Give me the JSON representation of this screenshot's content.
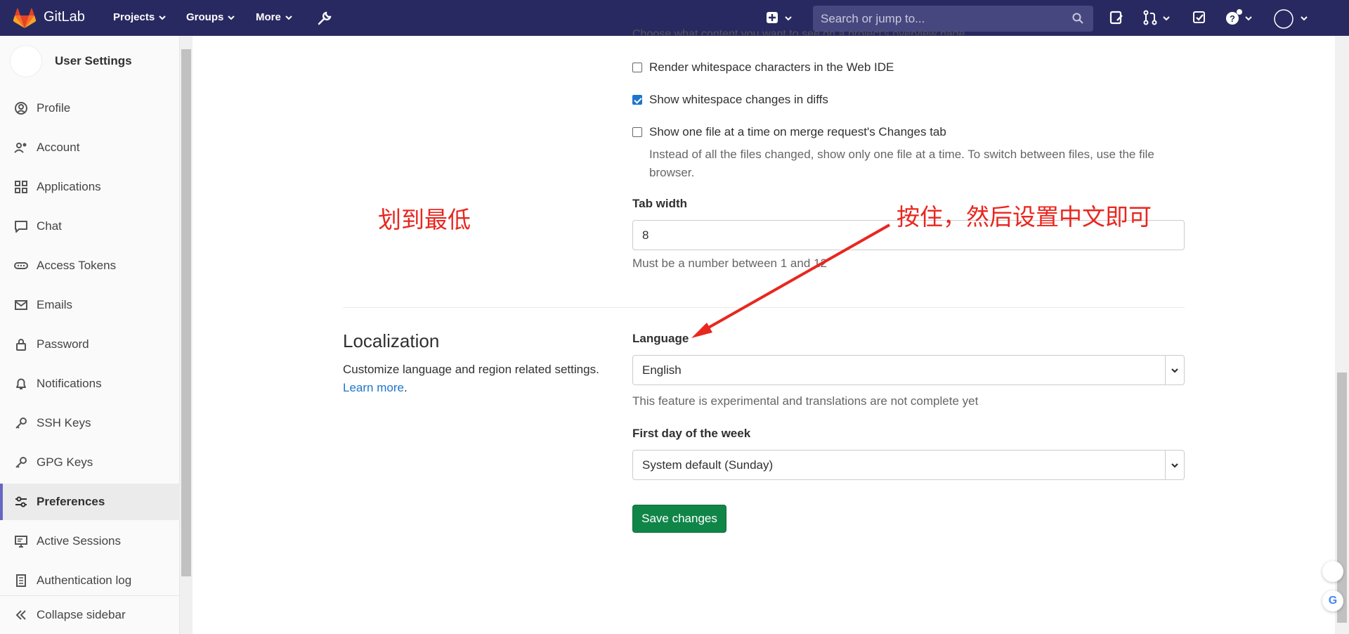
{
  "topbar": {
    "brand": "GitLab",
    "nav": [
      "Projects",
      "Groups",
      "More"
    ],
    "search_placeholder": "Search or jump to..."
  },
  "sidebar": {
    "title": "User Settings",
    "items": [
      {
        "label": "Profile",
        "icon": "profile-icon"
      },
      {
        "label": "Account",
        "icon": "account-icon"
      },
      {
        "label": "Applications",
        "icon": "applications-icon"
      },
      {
        "label": "Chat",
        "icon": "chat-icon"
      },
      {
        "label": "Access Tokens",
        "icon": "token-icon"
      },
      {
        "label": "Emails",
        "icon": "mail-icon"
      },
      {
        "label": "Password",
        "icon": "lock-icon"
      },
      {
        "label": "Notifications",
        "icon": "bell-icon"
      },
      {
        "label": "SSH Keys",
        "icon": "key-icon"
      },
      {
        "label": "GPG Keys",
        "icon": "key-icon"
      },
      {
        "label": "Preferences",
        "icon": "preferences-icon",
        "active": true
      },
      {
        "label": "Active Sessions",
        "icon": "monitor-icon"
      },
      {
        "label": "Authentication log",
        "icon": "log-icon"
      }
    ],
    "collapse_label": "Collapse sidebar"
  },
  "behavior": {
    "cut_text": "Choose what content you want to see on a project's overview page.",
    "checkboxes": [
      {
        "label": "Render whitespace characters in the Web IDE",
        "checked": false
      },
      {
        "label": "Show whitespace changes in diffs",
        "checked": true
      },
      {
        "label": "Show one file at a time on merge request's Changes tab",
        "checked": false
      }
    ],
    "one_file_help": "Instead of all the files changed, show only one file at a time. To switch between files, use the file browser.",
    "tab_width_label": "Tab width",
    "tab_width_value": "8",
    "tab_width_hint": "Must be a number between 1 and 12"
  },
  "localization": {
    "title": "Localization",
    "description": "Customize language and region related settings.",
    "learn_more": "Learn more",
    "learn_more_suffix": ".",
    "language_label": "Language",
    "language_value": "English",
    "language_hint": "This feature is experimental and translations are not complete yet",
    "first_day_label": "First day of the week",
    "first_day_value": "System default (Sunday)"
  },
  "save_label": "Save changes",
  "annotations": {
    "left_note": "划到最低",
    "right_note": "按住，然后设置中文即可",
    "color": "#e8271f"
  },
  "colors": {
    "topbar": "#292961",
    "save_button": "#108548",
    "link": "#1f75cb",
    "active_indicator": "#6666c4"
  }
}
